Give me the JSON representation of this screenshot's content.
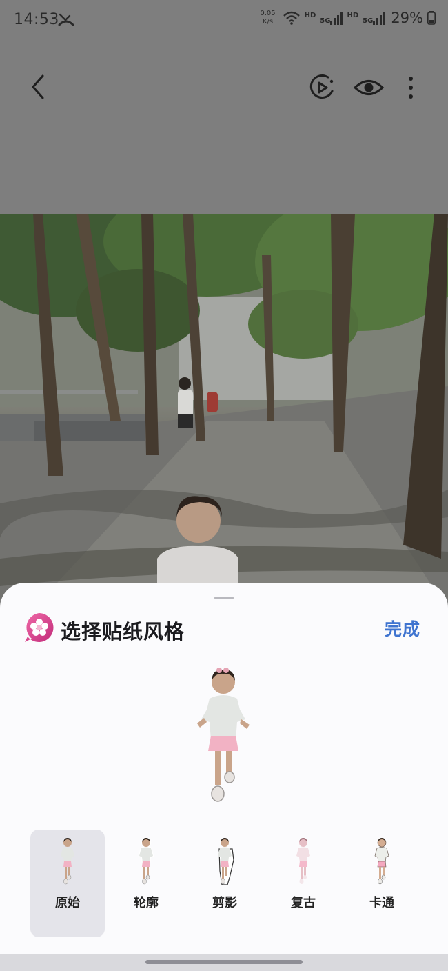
{
  "status_bar": {
    "time": "14:53",
    "net_speed_value": "0.05",
    "net_speed_unit": "K/s",
    "hd_label_1": "HD",
    "hd_label_2": "HD",
    "network_1": "5G",
    "network_2": "5G",
    "battery": "29%"
  },
  "app_bar": {
    "icons": [
      "back-icon",
      "motion-photo-icon",
      "eye-icon",
      "more-vert-icon"
    ]
  },
  "sheet": {
    "title": "选择贴纸风格",
    "done_label": "完成",
    "selected_style": "原始",
    "styles": [
      {
        "label": "原始"
      },
      {
        "label": "轮廓"
      },
      {
        "label": "剪影"
      },
      {
        "label": "复古"
      },
      {
        "label": "卡通"
      }
    ]
  },
  "colors": {
    "accent": "#3f74d0",
    "sheet_bg": "#fbfbfd",
    "selected_bg": "#e4e4ea",
    "scrim": "#7e7e7e"
  }
}
